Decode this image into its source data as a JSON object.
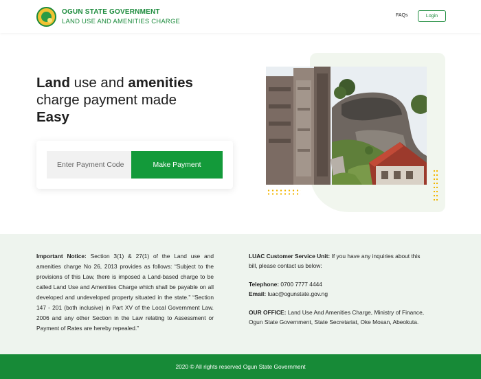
{
  "header": {
    "org_name": "OGUN STATE GOVERNMENT",
    "app_name": "LAND USE AND AMENITIES CHARGE",
    "faqs_label": "FAQs",
    "login_label": "Login"
  },
  "hero": {
    "line1_bold_a": "Land",
    "line1_normal": " use and ",
    "line1_bold_b": "amenities",
    "line2": "charge payment made",
    "line3": "Easy",
    "payment_input_placeholder": "Enter Payment Code",
    "payment_button_label": "Make Payment"
  },
  "notice": {
    "title": "Important Notice:",
    "body": " Section 3(1) & 27(1) of the Land use and amenities charge No 26, 2013 provides as follows: “Subject to the provisions of this Law, there is imposed a Land-based charge to be called Land Use and Amenities Charge which shall be payable on all developed and undeveloped property situated in the state.” “Section 147 - 201 (both inclusive) in Part XV of the Local Government Law. 2006 and any other Section in the Law relating to Assessment or Payment of Rates are hereby repealed.”"
  },
  "contact": {
    "unit_title": "LUAC Customer Service Unit:",
    "unit_text": " If you have any inquiries about this bill, please contact us below:",
    "telephone_label": "Telephone:",
    "telephone_value": " 0700 7777 4444",
    "email_label": "Email:",
    "email_value": " luac@ogunstate.gov.ng",
    "office_label": "OUR OFFICE:",
    "office_value": " Land Use And Amenities Charge, Ministry of Finance, Ogun State Government, State Secretariat, Oke Mosan, Abeokuta."
  },
  "footer": {
    "copyright": "2020 © All rights reserved Ogun State Government"
  },
  "colors": {
    "brand_green": "#139a3a",
    "footer_green": "#178a37",
    "accent_yellow": "#f2b600",
    "info_bg": "#eef4ee"
  }
}
